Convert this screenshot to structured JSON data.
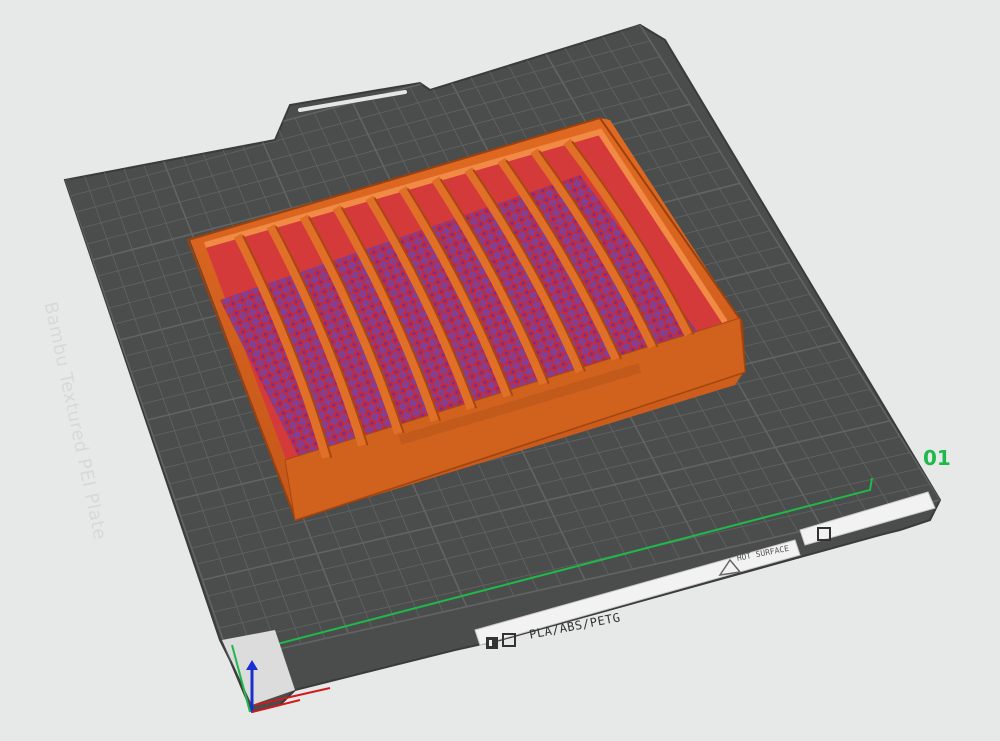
{
  "viewport": {
    "plate_label": "Bambu Textured PEI Plate",
    "plate_number": "01",
    "material_label": "PLA/ABS/PETG",
    "hot_surface_label": "HOT SURFACE",
    "colors": {
      "background": "#e7e9e9",
      "plate": "#4b4c4c",
      "grid": "#6a6c6c",
      "model_orange": "#d4611c",
      "model_red": "#d43a3a",
      "infill_purple": "#6a3fae",
      "axis_x": "#d11a1a",
      "axis_y": "#1fb84a",
      "axis_z": "#1a2fd1"
    },
    "icons": [
      "caution-icon",
      "bambu-logo-icon",
      "plate-type-icon",
      "view-toggle-icon"
    ]
  }
}
